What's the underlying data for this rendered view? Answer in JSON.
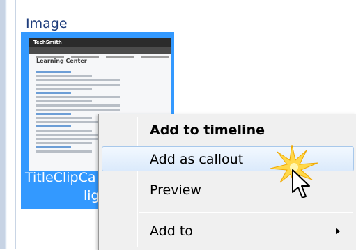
{
  "group": {
    "title": "Image"
  },
  "item": {
    "label_line1": "TitleClipCa",
    "label_line2": "lights",
    "thumbnail": {
      "logo": "TechSmith",
      "heading": "Learning Center"
    }
  },
  "context_menu": {
    "items": [
      {
        "label": "Add to timeline",
        "bold": true
      },
      {
        "label": "Add as callout",
        "highlighted": true
      },
      {
        "label": "Preview"
      },
      {
        "label": "Add to",
        "submenu": true
      }
    ]
  },
  "colors": {
    "selection": "#3399ff",
    "menu_bg": "#f0f0f0",
    "title": "#1e3d7c"
  },
  "cursor": {
    "icon": "arrow-cursor-icon",
    "effect": "click-burst-icon"
  }
}
